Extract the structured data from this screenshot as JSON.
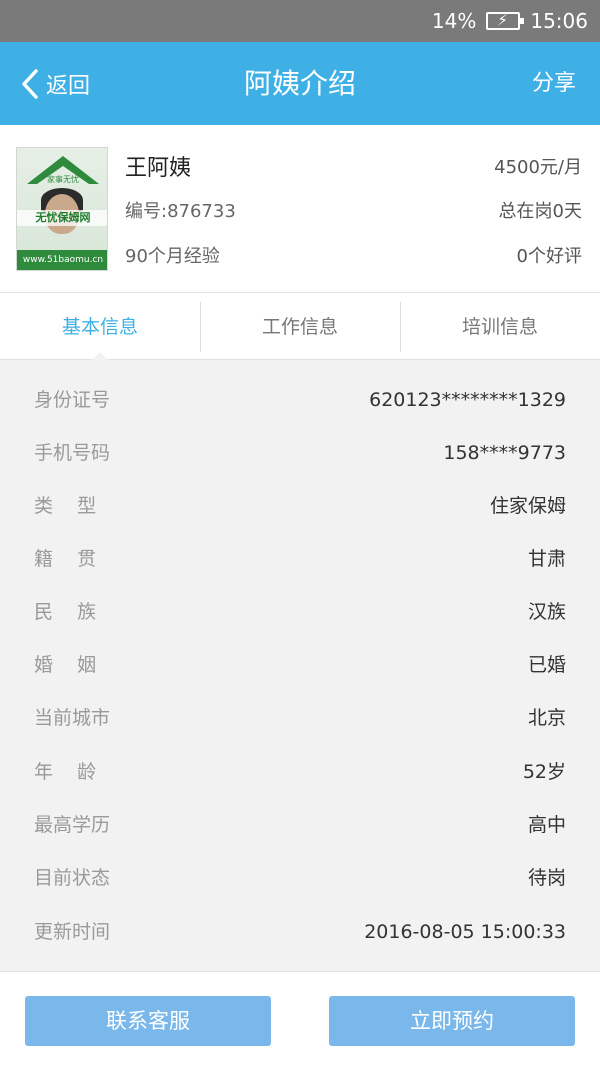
{
  "status_bar": {
    "battery": "14%",
    "time": "15:06"
  },
  "header": {
    "back_label": "返回",
    "title": "阿姨介绍",
    "share_label": "分享"
  },
  "profile": {
    "avatar_text": "无忧保姆网",
    "avatar_site": "www.51baomu.cn",
    "avatar_roof": "家事无忧",
    "name": "王阿姨",
    "code": "编号:876733",
    "experience": "90个月经验",
    "salary": "4500元/月",
    "on_duty": "总在岗0天",
    "praise": "0个好评"
  },
  "tabs": [
    {
      "label": "基本信息",
      "active": true
    },
    {
      "label": "工作信息",
      "active": false
    },
    {
      "label": "培训信息",
      "active": false
    }
  ],
  "info": [
    {
      "key": "身份证号",
      "value": "620123********1329"
    },
    {
      "key": "手机号码",
      "value": "158****9773"
    },
    {
      "key": "类    型",
      "value": "住家保姆"
    },
    {
      "key": "籍    贯",
      "value": "甘肃"
    },
    {
      "key": "民    族",
      "value": "汉族"
    },
    {
      "key": "婚    姻",
      "value": "已婚"
    },
    {
      "key": "当前城市",
      "value": "北京"
    },
    {
      "key": "年    龄",
      "value": "52岁"
    },
    {
      "key": "最高学历",
      "value": "高中"
    },
    {
      "key": "目前状态",
      "value": "待岗"
    },
    {
      "key": "更新时间",
      "value": "2016-08-05 15:00:33"
    }
  ],
  "footer": {
    "contact_label": "联系客服",
    "book_label": "立即预约"
  },
  "colors": {
    "header_bg": "#3fb0e6",
    "button_bg": "#7ab8ec",
    "active_tab": "#3fb0e6"
  }
}
